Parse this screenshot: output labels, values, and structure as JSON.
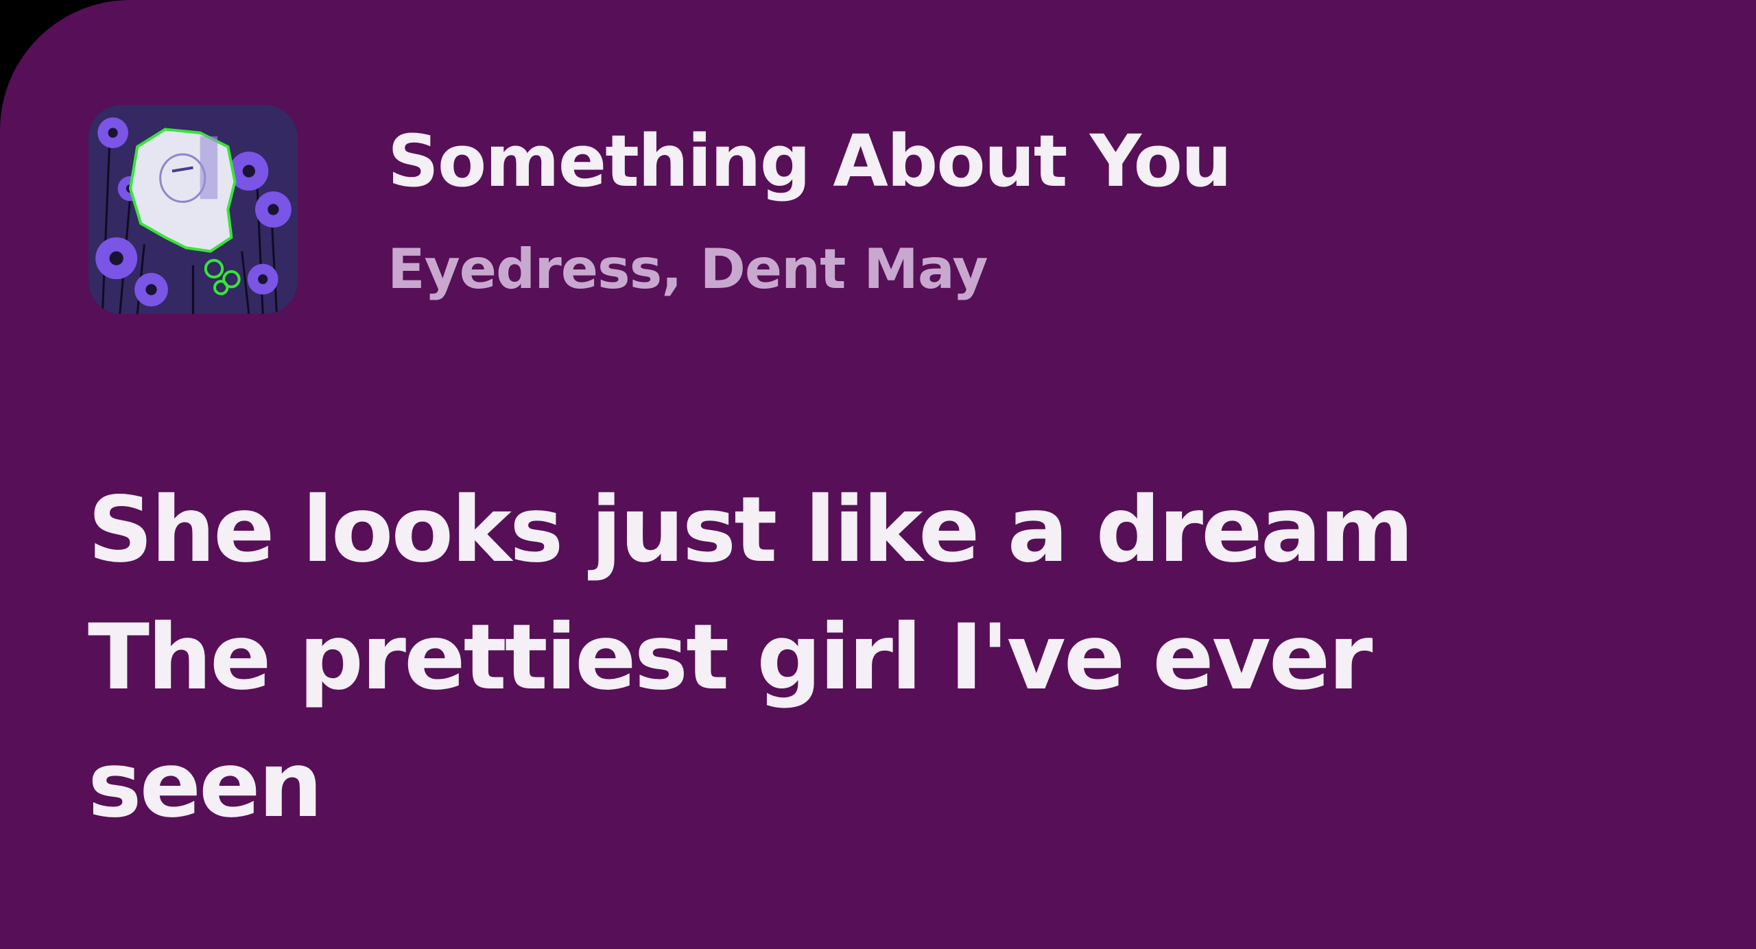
{
  "colors": {
    "card_background": "#570f57",
    "title_text": "#f4f0f6",
    "artist_text": "#c8a8cf",
    "lyrics_text": "#f4f0f6"
  },
  "track": {
    "title": "Something About You",
    "artists": "Eyedress, Dent May",
    "cover_icon": "album-cover-art"
  },
  "lyrics": {
    "lines": [
      "She looks just like a dream",
      "The prettiest girl I've ever",
      "seen"
    ]
  }
}
